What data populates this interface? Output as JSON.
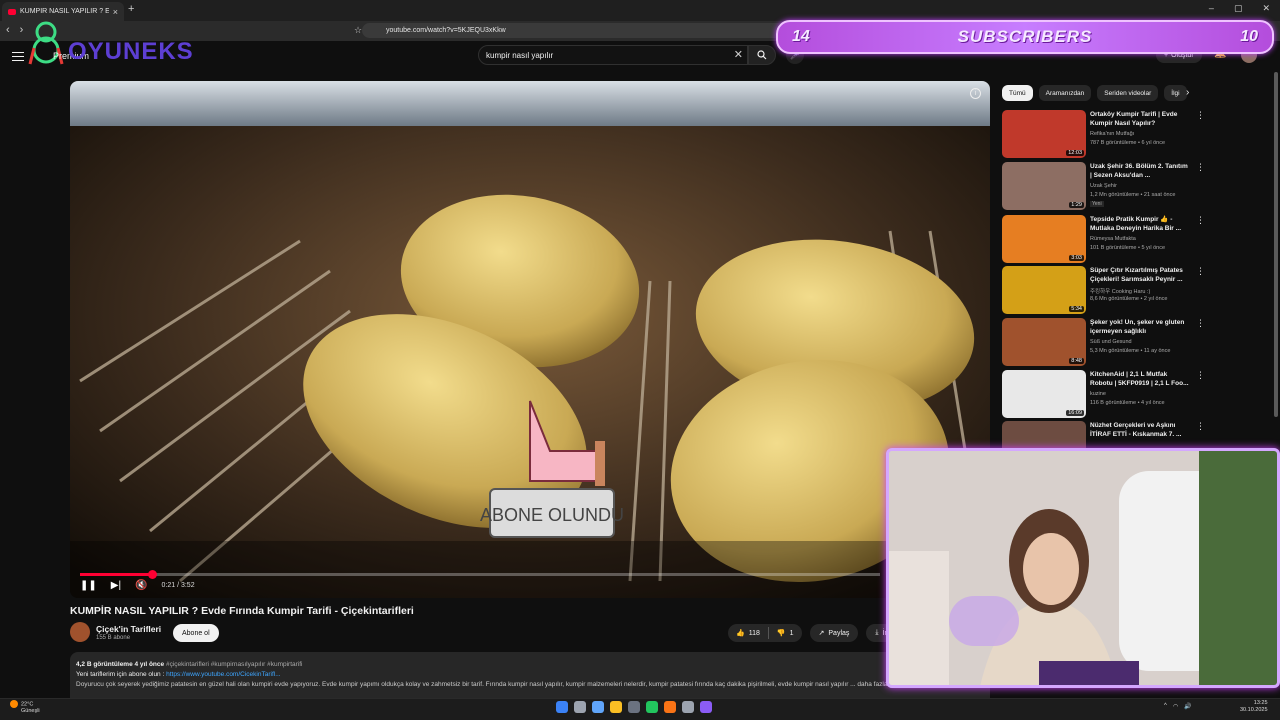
{
  "browser": {
    "tab_title": "KUMPİR NASIL YAPILIR ? Evde F...",
    "tab_close": "×",
    "new_tab": "+",
    "url": "youtube.com/watch?v=5KJEQU3xKkw",
    "window_controls": [
      "–",
      "▢",
      "✕"
    ]
  },
  "overlay": {
    "logo_text": "OYUNEKS",
    "premium_label": "Premium",
    "subs_left": "14",
    "subs_label": "SUBSCRIBERS",
    "subs_right": "10"
  },
  "header": {
    "search_value": "kumpir nasıl yapılır",
    "create_label": "Oluştur"
  },
  "player": {
    "time": "0:21 / 3:52",
    "progress_fraction": 0.09,
    "overlay_badge": "ABONE OLUNDU"
  },
  "video": {
    "title": "KUMPİR NASIL YAPILIR ? Evde Fırında Kumpir Tarifi - Çiçekintarifleri",
    "channel": "Çiçek'in Tarifleri",
    "subscribers": "155 B abone",
    "subscribe_label": "Abone ol",
    "likes": "118",
    "dislikes": "1",
    "share_label": "Paylaş",
    "download_label": "İndir"
  },
  "description": {
    "stats": "4,2 B görüntüleme  4 yıl önce",
    "tags": "#çiçekintarifleri #kumpirnasılyapılır #kumpirtarifi",
    "line2_prefix": "Yeni tariflerim için abone olun : ",
    "line2_link": "https://www.youtube.com/CicekinTarifl...",
    "line3": "Doyurucu çok seyerek yediğimiz patatesin en güzel hali olan kumpiri evde yapıyoruz. Evde kumpir yapımı oldukça kolay ve zahmetsiz bir tarif. Fırında kumpir nasıl yapılır, kumpir malzemeleri nelerdir, kumpir patatesi fırında kaç dakika pişirilmeli, evde kumpir nasıl yapılır ... daha fazla"
  },
  "chips": [
    "Tümü",
    "Aramanızdan",
    "Seriden videolar",
    "İlgi"
  ],
  "recommendations": [
    {
      "title": "Ortaköy Kumpir Tarifi | Evde Kumpir Nasıl Yapılır?",
      "channel": "Refika'nın Mutfağı",
      "meta": "787 B görüntüleme • 6 yıl önce",
      "duration": "12:03",
      "badge": "",
      "color": "#c0392b"
    },
    {
      "title": "Uzak Şehir 36. Bölüm 2. Tanıtım | Sezen Aksu'dan ...",
      "channel": "Uzak Şehir",
      "meta": "1,2 Mn görüntüleme • 21 saat önce",
      "duration": "1:29",
      "badge": "Yeni",
      "color": "#8d6e63"
    },
    {
      "title": "Tepside Pratik Kumpir 👍 - Mutlaka Deneyin Harika Bir ...",
      "channel": "Rümeysa Mutfakta",
      "meta": "101 B görüntüleme • 5 yıl önce",
      "duration": "3:03",
      "badge": "",
      "color": "#e67e22"
    },
    {
      "title": "Süper Çıtır Kızartılmış Patates Çiçekleri! Sarımsaklı Peynir ...",
      "channel": "주킹하우 Cooking Haru :)",
      "meta": "8,6 Mn görüntüleme • 2 yıl önce",
      "duration": "5:34",
      "badge": "",
      "color": "#d4a017"
    },
    {
      "title": "Şeker yok! Un, şeker ve gluten içermeyen sağlıklı kurabiyeler!...",
      "channel": "Süß und Gesund",
      "meta": "5,3 Mn görüntüleme • 11 ay önce",
      "duration": "8:48",
      "badge": "",
      "color": "#a0522d"
    },
    {
      "title": "KitchenAid | 2,1 L Mutfak Robotu | 5KFP0919 | 2,1 L Foo...",
      "channel": "kuzine",
      "meta": "116 B görüntüleme • 4 yıl önce",
      "duration": "16:09",
      "badge": "",
      "color": "#e8e8e8"
    },
    {
      "title": "Nüzhet Gerçekleri ve Aşkını İTİRAF ETTİ - Kıskanmak 7. ...",
      "channel": "",
      "meta": "",
      "duration": "",
      "badge": "",
      "color": "#6d4c41"
    }
  ],
  "taskbar": {
    "temp": "22°C",
    "weather": "Güneşli",
    "time": "13:25",
    "date": "30.10.2025"
  }
}
